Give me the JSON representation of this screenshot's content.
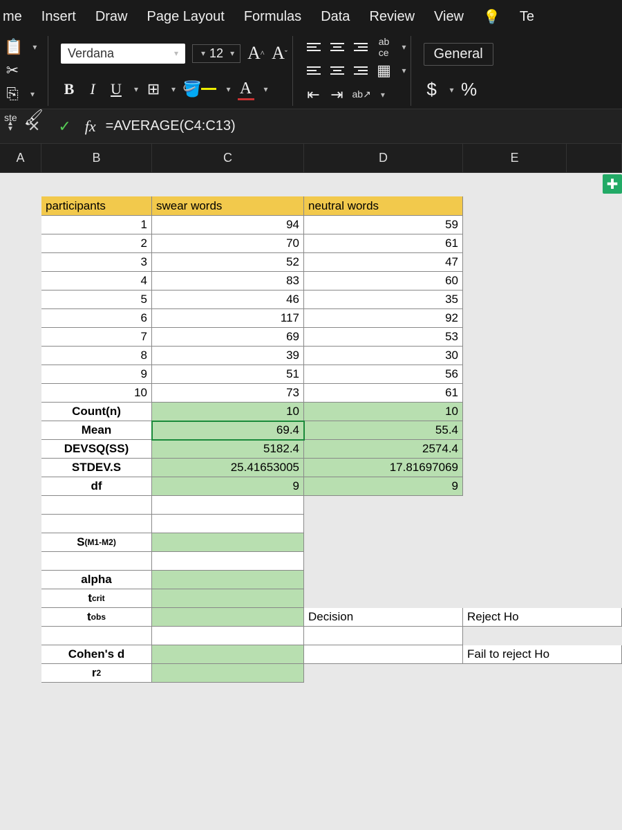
{
  "tabs": {
    "home": "me",
    "insert": "Insert",
    "draw": "Draw",
    "layout": "Page Layout",
    "formulas": "Formulas",
    "data": "Data",
    "review": "Review",
    "view": "View",
    "tell": "Te"
  },
  "paste_label": "ste",
  "font": {
    "name": "Verdana",
    "size": "12"
  },
  "number_format": "General",
  "currency": "$",
  "percent": "%",
  "formula_bar": {
    "fx": "fx",
    "formula": "=AVERAGE(C4:C13)"
  },
  "cols": {
    "a": "A",
    "b": "B",
    "c": "C",
    "d": "D",
    "e": "E"
  },
  "headers": {
    "participants": "participants",
    "swear": "swear words",
    "neutral": "neutral words"
  },
  "pdata": [
    {
      "p": "1",
      "s": "94",
      "n": "59"
    },
    {
      "p": "2",
      "s": "70",
      "n": "61"
    },
    {
      "p": "3",
      "s": "52",
      "n": "47"
    },
    {
      "p": "4",
      "s": "83",
      "n": "60"
    },
    {
      "p": "5",
      "s": "46",
      "n": "35"
    },
    {
      "p": "6",
      "s": "117",
      "n": "92"
    },
    {
      "p": "7",
      "s": "69",
      "n": "53"
    },
    {
      "p": "8",
      "s": "39",
      "n": "30"
    },
    {
      "p": "9",
      "s": "51",
      "n": "56"
    },
    {
      "p": "10",
      "s": "73",
      "n": "61"
    }
  ],
  "stats": {
    "count": {
      "label": "Count(n)",
      "s": "10",
      "n": "10"
    },
    "mean": {
      "label": "Mean",
      "s": "69.4",
      "n": "55.4"
    },
    "devsq": {
      "label": "DEVSQ(SS)",
      "s": "5182.4",
      "n": "2574.4"
    },
    "stdev": {
      "label": "STDEV.S",
      "s": "25.41653005",
      "n": "17.81697069"
    },
    "df": {
      "label": "df",
      "s": "9",
      "n": "9"
    }
  },
  "labels": {
    "sm1m2": "S",
    "sm1m2_sub": "(M1-M2)",
    "alpha": "alpha",
    "tcrit": "t",
    "tcrit_sub": "crit",
    "tobs": "t",
    "tobs_sub": "obs",
    "cohen": "Cohen's d",
    "r2": "r",
    "r2_sup": "2",
    "decision": "Decision",
    "reject": "Reject Ho",
    "fail": "Fail to reject Ho"
  }
}
